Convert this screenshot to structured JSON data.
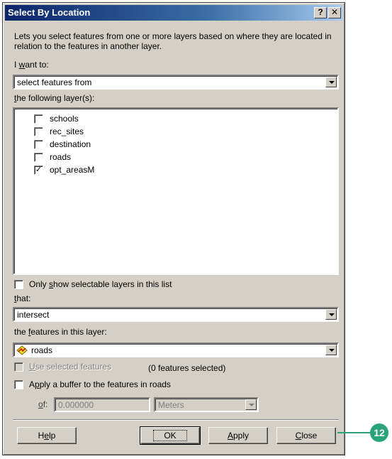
{
  "window": {
    "title": "Select By Location",
    "help_btn": "?",
    "close_btn": "✕"
  },
  "description": "Lets you select features from one or more layers based on where they are located in relation to the features in another layer.",
  "i_want": {
    "label_pre": "I ",
    "label_u": "w",
    "label_post": "ant to:",
    "value": "select features from"
  },
  "layers_label": {
    "u": "t",
    "post": "he following layer(s):"
  },
  "layers": [
    {
      "name": "schools",
      "checked": false,
      "mark": ""
    },
    {
      "name": "rec_sites",
      "checked": false,
      "mark": ""
    },
    {
      "name": "destination",
      "checked": false,
      "mark": ""
    },
    {
      "name": "roads",
      "checked": false,
      "mark": ""
    },
    {
      "name": "opt_areasM",
      "checked": true,
      "mark": "✓"
    }
  ],
  "only_show": {
    "pre": "Only ",
    "u": "s",
    "post": "how selectable layers in this list"
  },
  "that": {
    "label_u": "t",
    "label_post": "hat:",
    "value": "intersect"
  },
  "features_layer": {
    "label_pre": "the ",
    "label_u": "f",
    "label_post": "eatures in this layer:",
    "value": "roads"
  },
  "use_selected": {
    "u": "U",
    "post": "se selected features",
    "count": "(0 features selected)"
  },
  "buffer": {
    "pre": "A",
    "u": "p",
    "post": "ply a buffer to the features in roads"
  },
  "of_field": {
    "u": "o",
    "post": "f:",
    "value": "0.000000",
    "units": "Meters"
  },
  "buttons": {
    "help": {
      "pre": "H",
      "u": "e",
      "post": "lp"
    },
    "ok": "OK",
    "apply": {
      "u": "A",
      "post": "pply"
    },
    "close": {
      "u": "C",
      "post": "lose"
    }
  },
  "callout_number": "12",
  "colors": {
    "callout": "#2aa27a",
    "titlebar": "#0a246a",
    "face": "#d4d0c8"
  }
}
